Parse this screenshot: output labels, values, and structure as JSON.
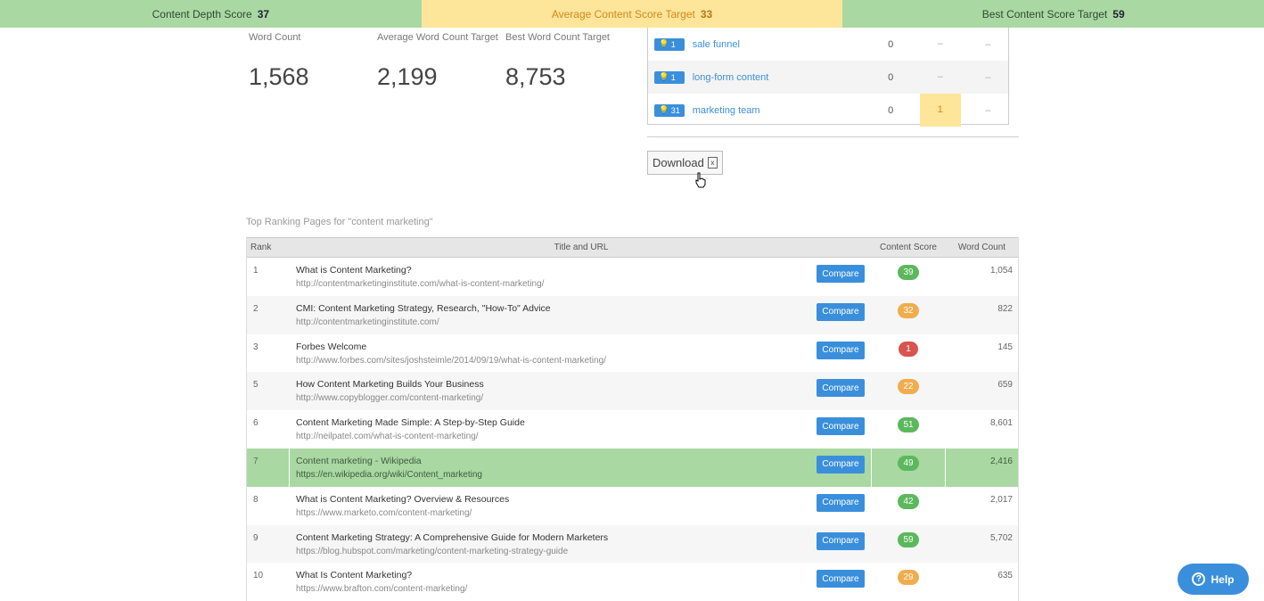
{
  "topbar": {
    "depth_label": "Content Depth Score",
    "depth_value": "37",
    "avg_label": "Average Content Score Target",
    "avg_value": "33",
    "best_label": "Best Content Score Target",
    "best_value": "59"
  },
  "stats": [
    {
      "label": "Word Count",
      "value": "1,568"
    },
    {
      "label": "Average Word Count Target",
      "value": "2,199"
    },
    {
      "label": "Best Word Count Target",
      "value": "8,753"
    }
  ],
  "keywords": [
    {
      "badge": "1",
      "keyword": "sale funnel",
      "c1": "0",
      "c2": "–",
      "c3": "–"
    },
    {
      "badge": "1",
      "keyword": "long-form content",
      "c1": "0",
      "c2": "–",
      "c3": "–"
    },
    {
      "badge": "31",
      "keyword": "marketing team",
      "c1": "0",
      "c2": "1",
      "c3": "–"
    }
  ],
  "download_label": "Download",
  "section_title": "Top Ranking Pages for \"content marketing\"",
  "table": {
    "headers": {
      "rank": "Rank",
      "title": "Title and URL",
      "score": "Content Score",
      "wc": "Word Count"
    },
    "compare_label": "Compare",
    "rows": [
      {
        "rank": "1",
        "title": "What is Content Marketing?",
        "url": "http://contentmarketinginstitute.com/what-is-content-marketing/",
        "score": "39",
        "color": "#5cb85c",
        "wc": "1,054"
      },
      {
        "rank": "2",
        "title": "CMI: Content Marketing Strategy, Research, \"How-To\" Advice",
        "url": "http://contentmarketinginstitute.com/",
        "score": "32",
        "color": "#f0ad4e",
        "wc": "822"
      },
      {
        "rank": "3",
        "title": "Forbes Welcome",
        "url": "http://www.forbes.com/sites/joshsteimle/2014/09/19/what-is-content-marketing/",
        "score": "1",
        "color": "#d9534f",
        "wc": "145"
      },
      {
        "rank": "5",
        "title": "How Content Marketing Builds Your Business",
        "url": "http://www.copyblogger.com/content-marketing/",
        "score": "22",
        "color": "#f0ad4e",
        "wc": "659"
      },
      {
        "rank": "6",
        "title": "Content Marketing Made Simple: A Step-by-Step Guide",
        "url": "http://neilpatel.com/what-is-content-marketing/",
        "score": "51",
        "color": "#5cb85c",
        "wc": "8,601"
      },
      {
        "rank": "7",
        "title": "Content marketing - Wikipedia",
        "url": "https://en.wikipedia.org/wiki/Content_marketing",
        "score": "49",
        "color": "#5cb85c",
        "wc": "2,416"
      },
      {
        "rank": "8",
        "title": "What is Content Marketing? Overview & Resources",
        "url": "https://www.marketo.com/content-marketing/",
        "score": "42",
        "color": "#5cb85c",
        "wc": "2,017"
      },
      {
        "rank": "9",
        "title": "Content Marketing Strategy: A Comprehensive Guide for Modern Marketers",
        "url": "https://blog.hubspot.com/marketing/content-marketing-strategy-guide",
        "score": "59",
        "color": "#5cb85c",
        "wc": "5,702"
      },
      {
        "rank": "10",
        "title": "What Is Content Marketing?",
        "url": "https://www.brafton.com/content-marketing/",
        "score": "29",
        "color": "#f0ad4e",
        "wc": "635"
      }
    ]
  },
  "help_label": "Help"
}
